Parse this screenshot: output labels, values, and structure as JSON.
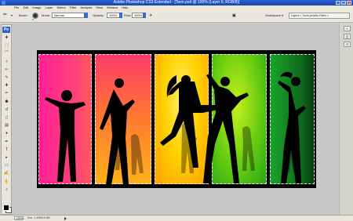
{
  "window": {
    "title": "Adobe Photoshop CS3 Extended - [Teen.psd @ 100% (Layer 6, RGB/8)]",
    "minimize": "_",
    "maximize": "□",
    "close": "×"
  },
  "menu": [
    "File",
    "Edit",
    "Image",
    "Layer",
    "Select",
    "Filter",
    "Analysis",
    "View",
    "Window",
    "Help"
  ],
  "options": {
    "brush_label": "Brush:",
    "brush_size": "9",
    "mode_label": "Mode:",
    "mode_value": "Normal",
    "opacity_label": "Opacity:",
    "opacity_value": "100%",
    "flow_label": "Flow:",
    "flow_value": "100%",
    "workspace_label": "Workspace ▾",
    "palette_tabs": "Layers × Tools presets Paths ×"
  },
  "tools": {
    "logo": "Ps",
    "icons": [
      "move-tool-icon",
      "marquee-tool-icon",
      "lasso-tool-icon",
      "magic-wand-icon",
      "crop-tool-icon",
      "eyedropper-icon",
      "healing-brush-icon",
      "brush-tool-icon",
      "clone-stamp-icon",
      "history-brush-icon",
      "eraser-icon",
      "gradient-tool-icon",
      "dodge-tool-icon",
      "pen-tool-icon",
      "type-tool-icon",
      "path-select-icon",
      "shape-tool-icon",
      "notes-tool-icon",
      "hand-tool-icon",
      "zoom-tool-icon"
    ],
    "glyphs": [
      "✚",
      "⬚",
      "⌒",
      "✧",
      "✄",
      "✎",
      "✚",
      "✏",
      "⚉",
      "↺",
      "▯",
      "▤",
      "●",
      "✒",
      "T",
      "▸",
      "▭",
      "✍",
      "✋",
      "⌕"
    ]
  },
  "status": {
    "zoom": "100%",
    "doc": "Doc: 1.43M/10.5M"
  },
  "colors": {
    "strip1": [
      "#ff2f9d",
      "#ff5a4a"
    ],
    "strip2": [
      "#ff4a6a",
      "#ff8a2a",
      "#ffb01a"
    ],
    "strip3": [
      "#ffb000",
      "#ffe000",
      "#ffef3a"
    ],
    "strip4": [
      "#8bd400",
      "#3fbe1a"
    ],
    "strip5": [
      "#1a9a2a",
      "#0a5a1a"
    ]
  }
}
